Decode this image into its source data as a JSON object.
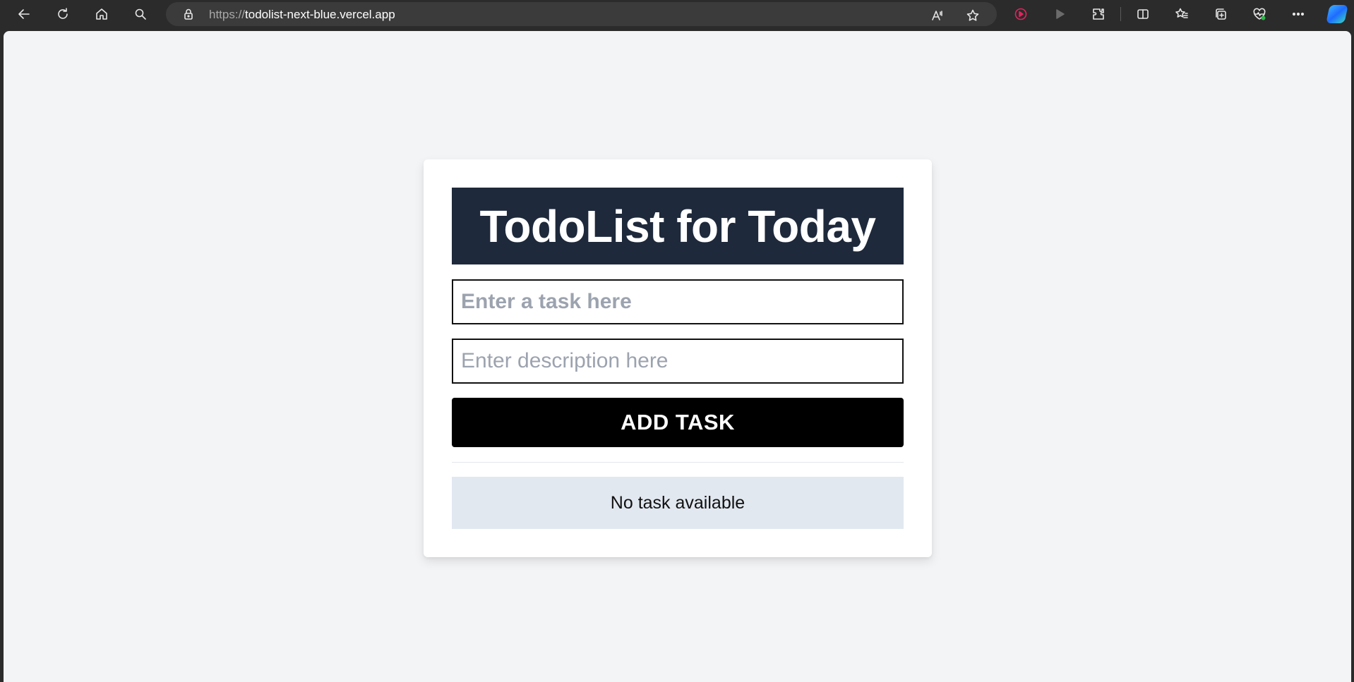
{
  "browser": {
    "url_scheme": "https://",
    "url_host": "todolist-next-blue.vercel.app",
    "icons": [
      "back-icon",
      "refresh-icon",
      "home-icon",
      "search-icon",
      "lock-icon",
      "read-aloud-icon",
      "favorite-star-icon",
      "record-icon",
      "play-icon",
      "extensions-icon",
      "split-screen-icon",
      "favorites-icon",
      "collections-icon",
      "health-icon",
      "more-icon",
      "copilot-icon"
    ]
  },
  "app": {
    "title": "TodoList for Today",
    "task_placeholder": "Enter a task here",
    "task_value": "",
    "description_placeholder": "Enter description here",
    "description_value": "",
    "add_button_label": "ADD TASK",
    "empty_message": "No task available",
    "colors": {
      "header_bg": "#1e293b",
      "button_bg": "#000000",
      "empty_bg": "#e2e8f0",
      "page_bg": "#f3f4f6"
    }
  }
}
